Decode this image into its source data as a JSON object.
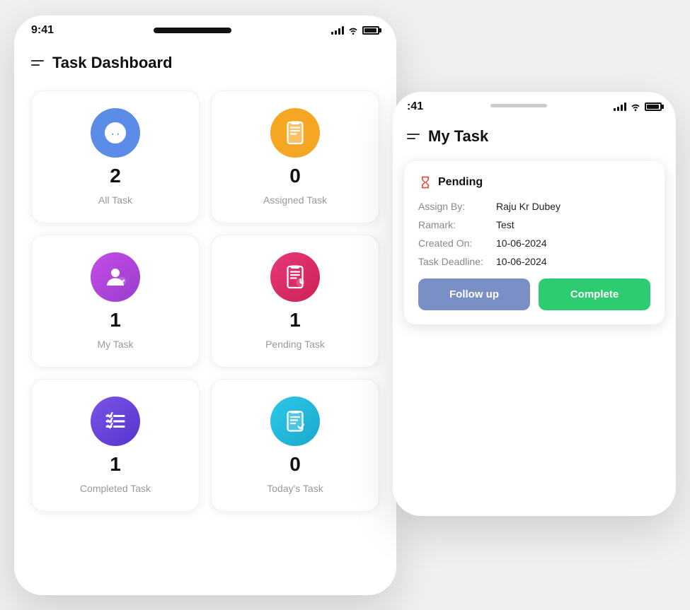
{
  "phone1": {
    "status": {
      "time": "9:41"
    },
    "header": {
      "title": "Task Dashboard"
    },
    "cards": [
      {
        "id": "all-task",
        "count": "2",
        "label": "All Task",
        "color": "#5b8de8",
        "icon": "filter"
      },
      {
        "id": "assigned-task",
        "count": "0",
        "label": "Assigned Task",
        "color": "#f5a623",
        "icon": "clipboard"
      },
      {
        "id": "my-task",
        "count": "1",
        "label": "My Task",
        "color": "#c44de8",
        "icon": "person-check"
      },
      {
        "id": "pending-task",
        "count": "1",
        "label": "Pending Task",
        "color": "#e8387a",
        "icon": "clipboard-clock"
      },
      {
        "id": "completed-task",
        "count": "1",
        "label": "Completed Task",
        "color": "#7c55e8",
        "icon": "checklist"
      },
      {
        "id": "todays-task",
        "count": "0",
        "label": "Today's Task",
        "color": "#2dc8e8",
        "icon": "clipboard-pen"
      }
    ]
  },
  "phone2": {
    "status": {
      "time": ":41"
    },
    "header": {
      "title": "My Task"
    },
    "task": {
      "status": "Pending",
      "assign_by_label": "Assign By:",
      "assign_by_value": "Raju Kr Dubey",
      "remark_label": "Ramark:",
      "remark_value": "Test",
      "created_on_label": "Created On:",
      "created_on_value": "10-06-2024",
      "deadline_label": "Task Deadline:",
      "deadline_value": "10-06-2024",
      "followup_btn": "Follow up",
      "complete_btn": "Complete"
    }
  }
}
